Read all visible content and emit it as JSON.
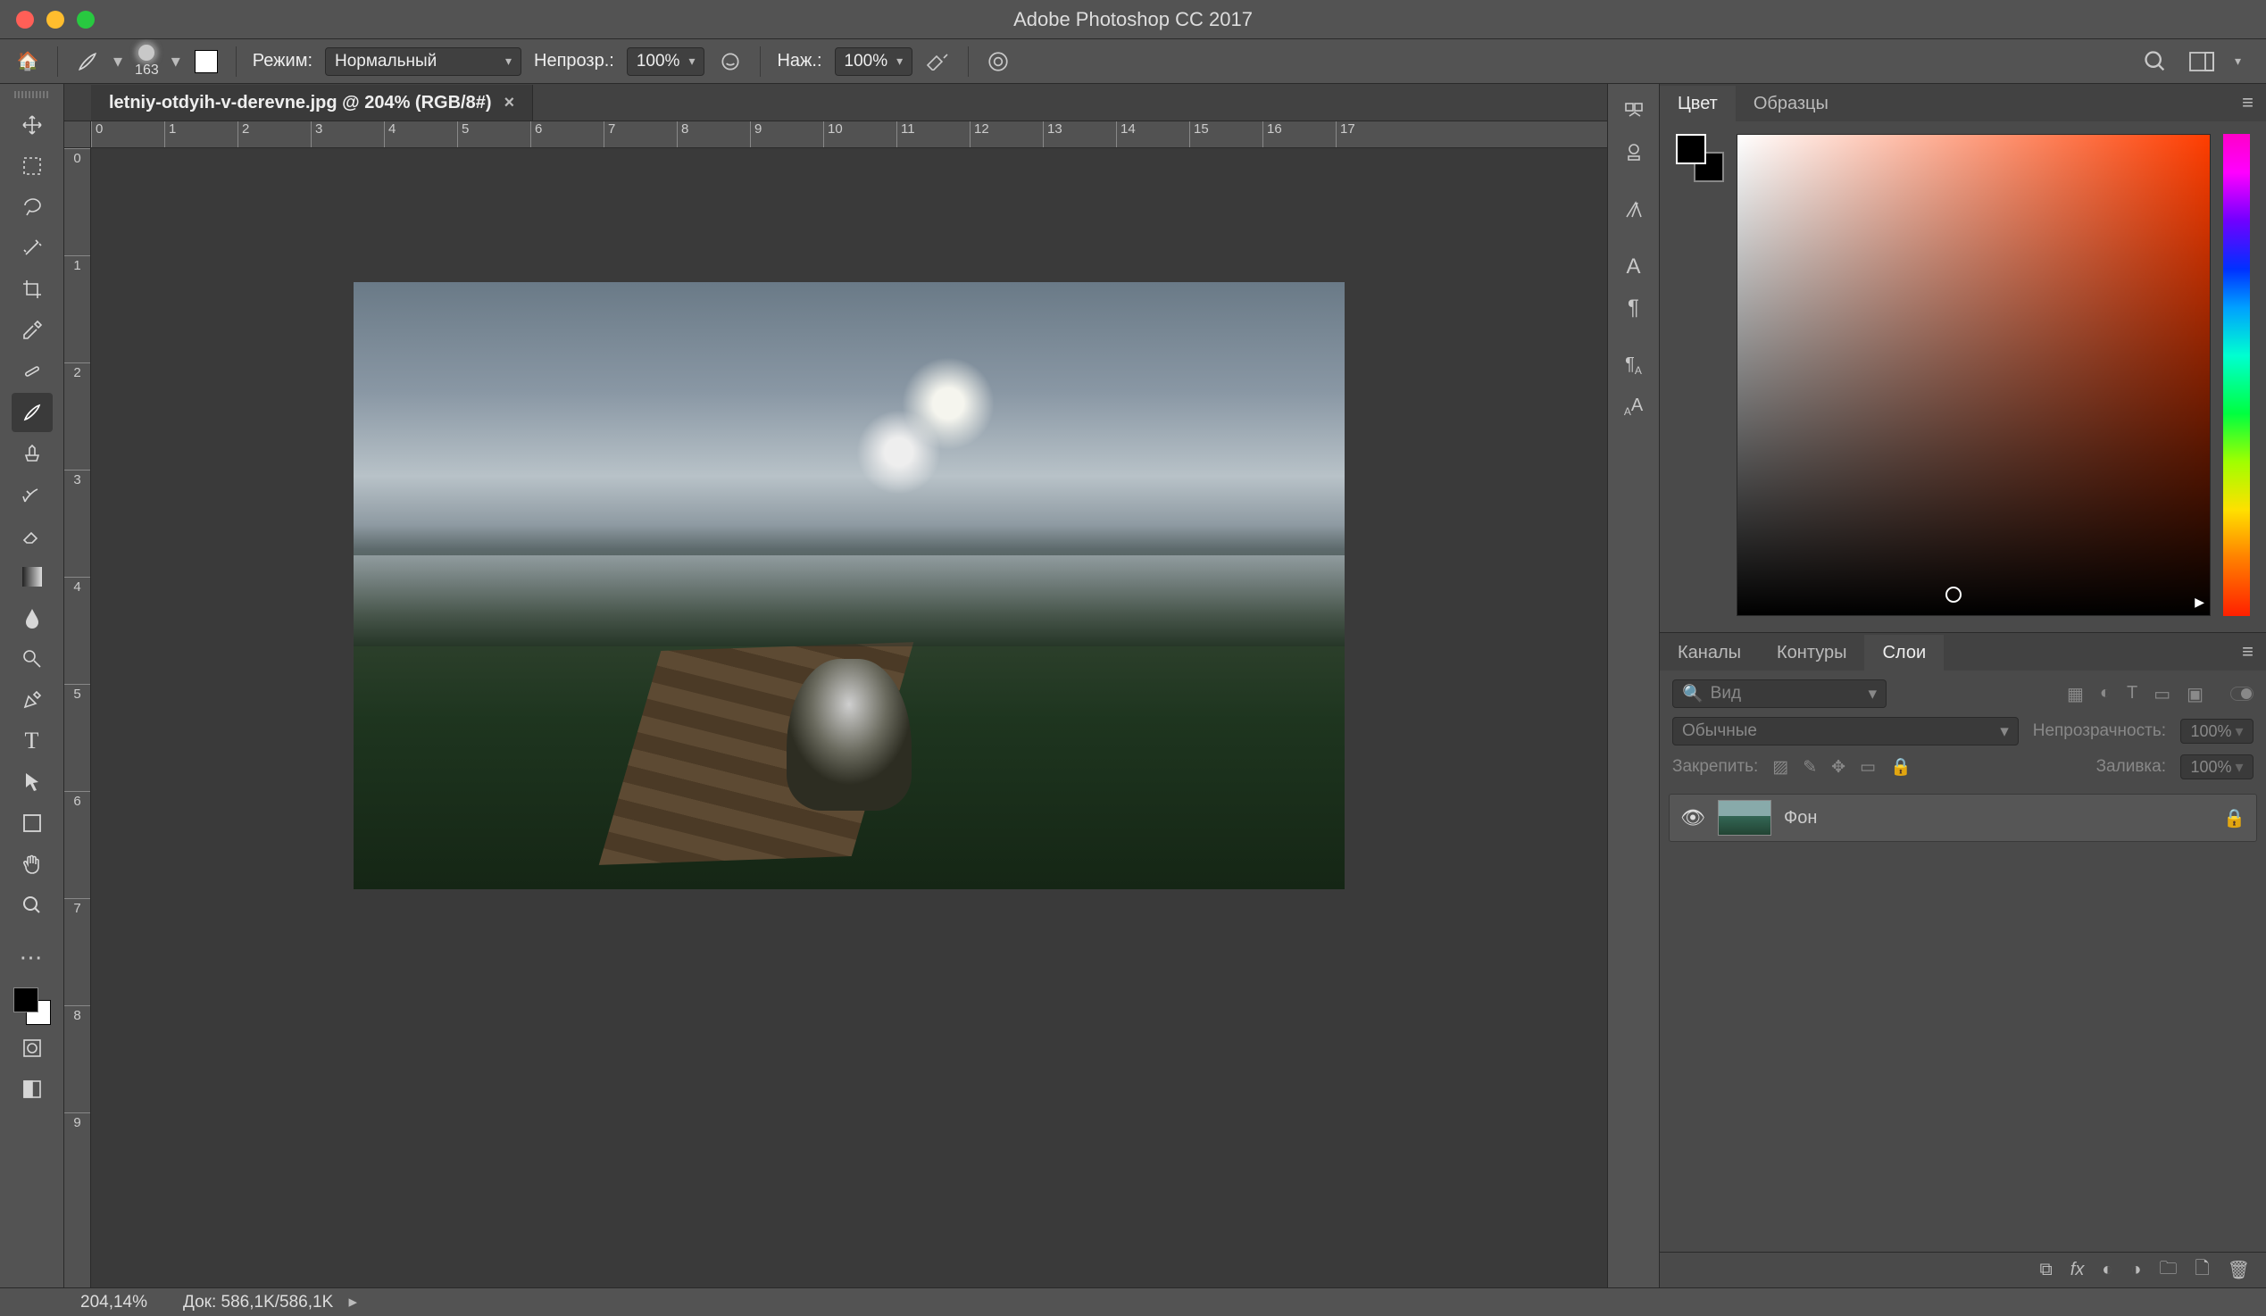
{
  "window": {
    "title": "Adobe Photoshop CC 2017"
  },
  "optbar": {
    "brush_size": "163",
    "mode_label": "Режим:",
    "blend_mode": "Нормальный",
    "opacity_label": "Непрозр.:",
    "opacity_value": "100%",
    "flow_label": "Наж.:",
    "flow_value": "100%"
  },
  "document": {
    "tab_title": "letniy-otdyih-v-derevne.jpg @ 204% (RGB/8#)"
  },
  "ruler_h": [
    "0",
    "1",
    "2",
    "3",
    "4",
    "5",
    "6",
    "7",
    "8",
    "9",
    "10",
    "11",
    "12",
    "13",
    "14",
    "15",
    "16",
    "17"
  ],
  "ruler_v": [
    "0",
    "1",
    "2",
    "3",
    "4",
    "5",
    "6",
    "7",
    "8",
    "9"
  ],
  "right_tabs_color": {
    "color": "Цвет",
    "swatches": "Образцы"
  },
  "right_tabs_layers": {
    "channels": "Каналы",
    "paths": "Контуры",
    "layers": "Слои"
  },
  "layers": {
    "kind_placeholder": "Вид",
    "blend_mode": "Обычные",
    "opacity_label": "Непрозрачность:",
    "opacity_value": "100%",
    "lock_label": "Закрепить:",
    "fill_label": "Заливка:",
    "fill_value": "100%",
    "items": [
      {
        "name": "Фон"
      }
    ]
  },
  "status": {
    "zoom": "204,14%",
    "doc_label": "Док:",
    "doc_value": "586,1K/586,1K"
  }
}
